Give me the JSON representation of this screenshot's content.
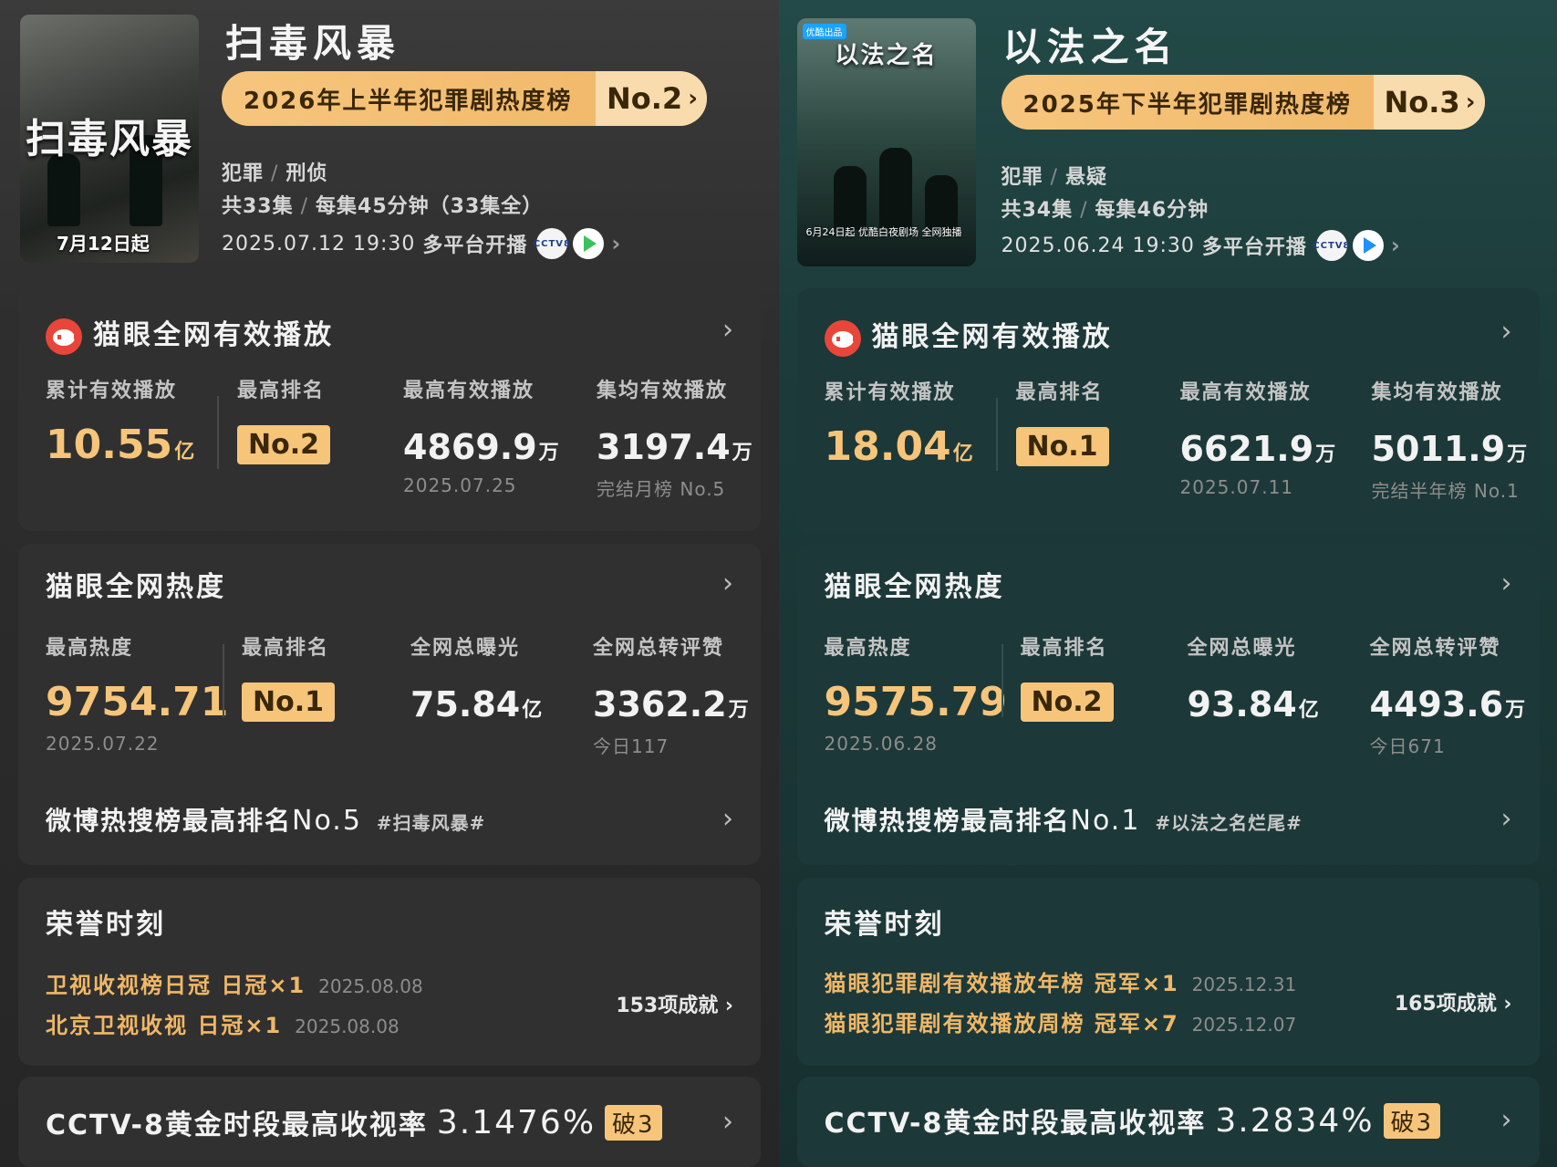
{
  "left": {
    "poster": {
      "title": "扫毒风暴",
      "date": "7月12日起"
    },
    "title": "扫毒风暴",
    "rank": {
      "label": "2026年上半年犯罪剧热度榜",
      "no": "No.2"
    },
    "genres": [
      "犯罪",
      "刑侦"
    ],
    "episodes": "共33集",
    "duration": "每集45分钟（33集全）",
    "air": {
      "date": "2025.07.12 19:30",
      "text": "多平台开播"
    },
    "platform_icons": [
      "cctv8-icon",
      "green-play-icon"
    ],
    "maoyan": {
      "title": "猫眼全网有效播放",
      "cols": [
        {
          "label": "累计有效播放",
          "value": "10.55",
          "unit": "亿"
        },
        {
          "label": "最高排名",
          "value": "No.2"
        },
        {
          "label": "最高有效播放",
          "value": "4869.9",
          "unit": "万",
          "sub": "2025.07.25"
        },
        {
          "label": "集均有效播放",
          "value": "3197.4",
          "unit": "万",
          "sub": "完结月榜 No.5"
        }
      ]
    },
    "heat": {
      "title": "猫眼全网热度",
      "cols": [
        {
          "label": "最高热度",
          "value": "9754.71",
          "sub": "2025.07.22"
        },
        {
          "label": "最高排名",
          "value": "No.1"
        },
        {
          "label": "全网总曝光",
          "value": "75.84",
          "unit": "亿"
        },
        {
          "label": "全网总转评赞",
          "value": "3362.2",
          "unit": "万",
          "sub": "今日117"
        }
      ],
      "weibo": {
        "text": "微博热搜榜最高排名",
        "no": "No.5",
        "tag": "#扫毒风暴#"
      }
    },
    "honor": {
      "title": "荣誉时刻",
      "items": [
        {
          "text": "卫视收视榜日冠 日冠×1",
          "date": "2025.08.08"
        },
        {
          "text": "北京卫视收视 日冠×1",
          "date": "2025.08.08"
        }
      ],
      "count": "153项成就"
    },
    "cctv": {
      "text": "CCTV-8黄金时段最高收视率",
      "value": "3.1476%",
      "badge": "破3"
    }
  },
  "right": {
    "poster": {
      "title": "以法之名",
      "badge": "优酷出品",
      "footer": "6月24日起 优酷白夜剧场 全网独播"
    },
    "title": "以法之名",
    "rank": {
      "label": "2025年下半年犯罪剧热度榜",
      "no": "No.3"
    },
    "genres": [
      "犯罪",
      "悬疑"
    ],
    "episodes": "共34集",
    "duration": "每集46分钟",
    "air": {
      "date": "2025.06.24 19:30",
      "text": "多平台开播"
    },
    "platform_icons": [
      "cctv8-icon",
      "youku-play-icon"
    ],
    "maoyan": {
      "title": "猫眼全网有效播放",
      "cols": [
        {
          "label": "累计有效播放",
          "value": "18.04",
          "unit": "亿"
        },
        {
          "label": "最高排名",
          "value": "No.1"
        },
        {
          "label": "最高有效播放",
          "value": "6621.9",
          "unit": "万",
          "sub": "2025.07.11"
        },
        {
          "label": "集均有效播放",
          "value": "5011.9",
          "unit": "万",
          "sub": "完结半年榜 No.1"
        }
      ]
    },
    "heat": {
      "title": "猫眼全网热度",
      "cols": [
        {
          "label": "最高热度",
          "value": "9575.79",
          "sub": "2025.06.28"
        },
        {
          "label": "最高排名",
          "value": "No.2"
        },
        {
          "label": "全网总曝光",
          "value": "93.84",
          "unit": "亿"
        },
        {
          "label": "全网总转评赞",
          "value": "4493.6",
          "unit": "万",
          "sub": "今日671"
        }
      ],
      "weibo": {
        "text": "微博热搜榜最高排名",
        "no": "No.1",
        "tag": "#以法之名烂尾#"
      }
    },
    "honor": {
      "title": "荣誉时刻",
      "items": [
        {
          "text": "猫眼犯罪剧有效播放年榜 冠军×1",
          "date": "2025.12.31"
        },
        {
          "text": "猫眼犯罪剧有效播放周榜 冠军×7",
          "date": "2025.12.07"
        }
      ],
      "count": "165项成就"
    },
    "cctv": {
      "text": "CCTV-8黄金时段最高收视率",
      "value": "3.2834%",
      "badge": "破3"
    }
  },
  "colors": {
    "gold": "#f6c57a",
    "left_bg": "#2d2d2d",
    "right_bg": "#1c3b3a",
    "maoyan_red": "#e8463a"
  }
}
